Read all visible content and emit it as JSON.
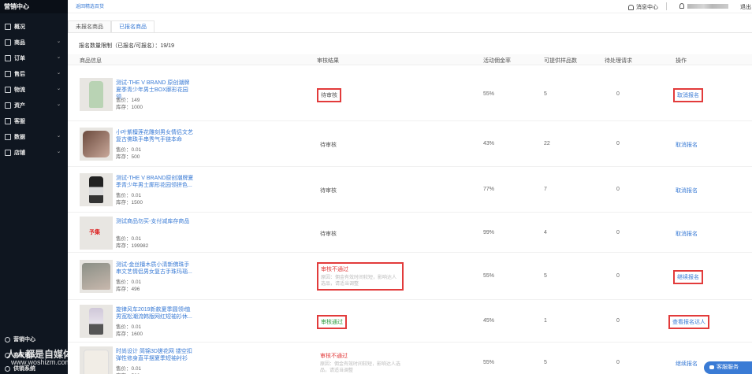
{
  "app": {
    "title": "营销中心"
  },
  "sidebar": {
    "items": [
      {
        "label": "概况",
        "icon": "grid-icon",
        "has_children": false
      },
      {
        "label": "商品",
        "icon": "bag-icon",
        "has_children": true
      },
      {
        "label": "订单",
        "icon": "order-icon",
        "has_children": true
      },
      {
        "label": "售后",
        "icon": "aftersale-icon",
        "has_children": true
      },
      {
        "label": "物流",
        "icon": "truck-icon",
        "has_children": true
      },
      {
        "label": "资产",
        "icon": "wallet-icon",
        "has_children": true
      },
      {
        "label": "客服",
        "icon": "headset-icon",
        "has_children": false
      },
      {
        "label": "数据",
        "icon": "chart-icon",
        "has_children": true
      },
      {
        "label": "店铺",
        "icon": "store-icon",
        "has_children": true
      }
    ],
    "bottom": [
      {
        "label": "营销中心",
        "icon": "marketing-icon"
      },
      {
        "label": "商家论坛",
        "icon": "forum-icon"
      },
      {
        "label": "供销系统",
        "icon": "supply-icon"
      }
    ]
  },
  "header": {
    "back_link": "返回精选百货",
    "notice": "消息中心",
    "logout": "退出"
  },
  "tabs": [
    {
      "label": "未报名商品",
      "active": false
    },
    {
      "label": "已报名商品",
      "active": true
    }
  ],
  "quota": {
    "label": "报名数量限制（已报名/可报名）：",
    "value": "19/19"
  },
  "table": {
    "headers": [
      "商品信息",
      "审核结果",
      "活动佣金率",
      "可提供样品数",
      "待处理请求",
      "操作"
    ],
    "price_label": "售价：",
    "stock_label": "库存：",
    "rows": [
      {
        "title": "测试-THE V BRAND 原创潮牌夏季青少年男士BOX廓形花园领...",
        "price": "149",
        "stock": "1000",
        "status": "待审核",
        "status_type": "pending",
        "reason": "",
        "commission": "55%",
        "samples": "5",
        "requests": "0",
        "action": "取消报名",
        "thumb": "shirt-green",
        "highlight_status": true,
        "highlight_action": true
      },
      {
        "title": "小叶紫檀莲花雕刻男女情侣文艺复古佛珠手串秀气手链本命",
        "price": "0.01",
        "stock": "500",
        "status": "待审核",
        "status_type": "pending",
        "reason": "",
        "commission": "43%",
        "samples": "22",
        "requests": "0",
        "action": "取消报名",
        "thumb": "bracelet",
        "highlight_status": false,
        "highlight_action": false
      },
      {
        "title": "测试-THE V BRAND原创潮牌夏季青少年男士廓形花园领拼色...",
        "price": "0.01",
        "stock": "1500",
        "status": "待审核",
        "status_type": "pending",
        "reason": "",
        "commission": "77%",
        "samples": "7",
        "requests": "0",
        "action": "取消报名",
        "thumb": "shirt-black",
        "highlight_status": false,
        "highlight_action": false
      },
      {
        "title": "测试商品勿买-支付减库存商品",
        "price": "0.01",
        "stock": "199982",
        "status": "待审核",
        "status_type": "pending",
        "reason": "",
        "commission": "99%",
        "samples": "4",
        "requests": "0",
        "action": "取消报名",
        "thumb": "text-logo",
        "highlight_status": false,
        "highlight_action": false
      },
      {
        "title": "测试-金丝檀木质小清新佛珠手串文艺情侣男女复古手珠玛瑙...",
        "price": "0.01",
        "stock": "496",
        "status": "审核不通过",
        "status_type": "rejected",
        "reason": "原因：佣金有效时间较短，影响达人选品，请适当调整",
        "commission": "55%",
        "samples": "5",
        "requests": "0",
        "action": "继续报名",
        "thumb": "bracelet-hand",
        "highlight_status": true,
        "highlight_action": true
      },
      {
        "title": "旋律风车2019新款夏季圆领t恤男宽松潮流韩版网红短袖衫休...",
        "price": "0.01",
        "stock": "1600",
        "status": "审核通过",
        "status_type": "approved",
        "reason": "",
        "commission": "45%",
        "samples": "1",
        "requests": "0",
        "action": "查看报名达人",
        "thumb": "tshirt-model",
        "highlight_status": true,
        "highlight_action": true
      },
      {
        "title": "时尚设计 简锦3D搓花网 镂空扣弹性修身直平摆夏季短袖衬衫",
        "price": "0.01",
        "stock": "500",
        "status": "审核不通过",
        "status_type": "rejected",
        "reason": "原因：佣金有效时间较短，影响达人选品，请适当调整",
        "commission": "55%",
        "samples": "5",
        "requests": "0",
        "action": "继续报名",
        "thumb": "shirt-white",
        "highlight_status": false,
        "highlight_action": false
      }
    ]
  },
  "service_button": "客服服务",
  "watermark": {
    "text": "人人都是自媒体",
    "url": "www.woshizm.com"
  },
  "colors": {
    "sidebar_bg": "#0f1620",
    "link": "#3a7bd5",
    "highlight": "#e23b3b",
    "reject": "#e23b3b",
    "approve": "#2e9b3e"
  }
}
